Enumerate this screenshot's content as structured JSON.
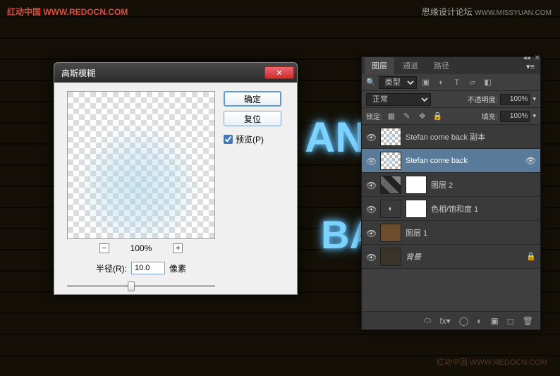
{
  "watermarks": {
    "left": "红动中国 WWW.REDOCN.COM",
    "right_label": "思缘设计论坛",
    "right_url": "WWW.MISSYUAN.COM",
    "bottom": "红动中国 WWW.REDOCN.COM"
  },
  "neon": {
    "text1": "AN",
    "text2": "BA"
  },
  "dialog": {
    "title": "高斯模糊",
    "ok": "确定",
    "reset": "复位",
    "preview": "预览(P)",
    "zoom": "100%",
    "radius_label": "半径(R):",
    "radius_value": "10.0",
    "unit": "像素"
  },
  "panel": {
    "tabs": [
      "图层",
      "通道",
      "路径"
    ],
    "type_label": "类型",
    "blend_mode": "正常",
    "opacity_label": "不透明度:",
    "opacity_value": "100%",
    "lock_label": "锁定:",
    "fill_label": "填充:",
    "fill_value": "100%",
    "layers": [
      {
        "name": "Stefan  come back 副本"
      },
      {
        "name": "Stefan  come back"
      },
      {
        "name": "图层 2"
      },
      {
        "name": "色相/饱和度 1"
      },
      {
        "name": "图层 1"
      },
      {
        "name": "背景"
      }
    ]
  }
}
